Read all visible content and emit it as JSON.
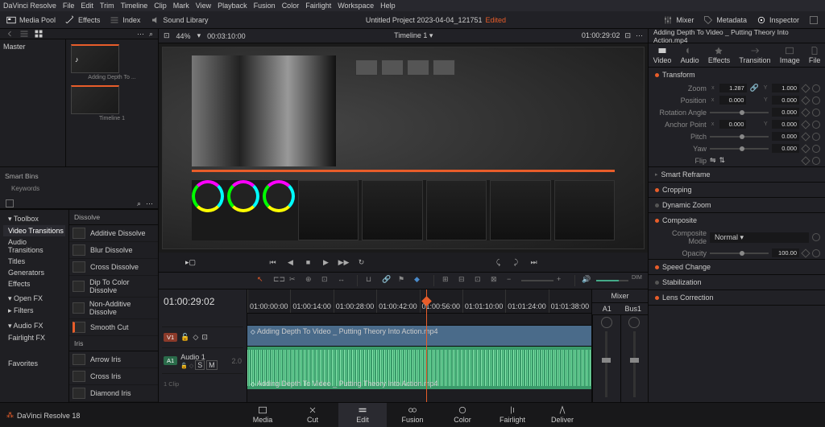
{
  "menubar": [
    "DaVinci Resolve",
    "File",
    "Edit",
    "Trim",
    "Timeline",
    "Clip",
    "Mark",
    "View",
    "Playback",
    "Fusion",
    "Color",
    "Fairlight",
    "Workspace",
    "Help"
  ],
  "topbar": {
    "left": [
      {
        "icon": "media-pool",
        "label": "Media Pool",
        "active": true
      },
      {
        "icon": "effects",
        "label": "Effects",
        "active": true
      },
      {
        "icon": "index",
        "label": "Index"
      },
      {
        "icon": "sound",
        "label": "Sound Library"
      }
    ],
    "title": "Untitled Project 2023-04-04_121751",
    "edited": "Edited",
    "right": [
      {
        "icon": "mixer",
        "label": "Mixer"
      },
      {
        "icon": "metadata",
        "label": "Metadata"
      },
      {
        "icon": "inspector",
        "label": "Inspector",
        "active": true
      }
    ]
  },
  "viewer": {
    "zoom": "44%",
    "left_tc": "00:03:10:00",
    "timeline_name": "Timeline 1",
    "right_tc": "01:00:29:02"
  },
  "mediapool": {
    "master": "Master",
    "thumbs": [
      {
        "label": "Adding Depth To ..."
      },
      {
        "label": "Timeline 1"
      }
    ],
    "smart_bins_hdr": "Smart Bins",
    "smart_bins": [
      "Keywords"
    ]
  },
  "toolbox": {
    "header": "Toolbox",
    "tree": [
      "Video Transitions",
      "Audio Transitions",
      "Titles",
      "Generators",
      "Effects"
    ],
    "openfx": "Open FX",
    "filters": "Filters",
    "audiofx": "Audio FX",
    "fairlight": "Fairlight FX",
    "favorites": "Favorites",
    "dissolve_hdr": "Dissolve",
    "dissolves": [
      "Additive Dissolve",
      "Blur Dissolve",
      "Cross Dissolve",
      "Dip To Color Dissolve",
      "Non-Additive Dissolve",
      "Smooth Cut"
    ],
    "iris_hdr": "Iris",
    "iris": [
      "Arrow Iris",
      "Cross Iris",
      "Diamond Iris"
    ]
  },
  "inspector": {
    "clip": "Adding Depth To Video _ Putting Theory Into Action.mp4",
    "tabs": [
      "Video",
      "Audio",
      "Effects",
      "Transition",
      "Image",
      "File"
    ],
    "transform": {
      "header": "Transform",
      "zoom": "Zoom",
      "zoom_x": "1.287",
      "zoom_y": "1.000",
      "position": "Position",
      "pos_x": "0.000",
      "pos_y": "0.000",
      "rotation": "Rotation Angle",
      "rotation_v": "0.000",
      "anchor": "Anchor Point",
      "anchor_x": "0.000",
      "anchor_y": "0.000",
      "pitch": "Pitch",
      "pitch_v": "0.000",
      "yaw": "Yaw",
      "yaw_v": "0.000",
      "flip": "Flip"
    },
    "sections": [
      "Smart Reframe",
      "Cropping",
      "Dynamic Zoom",
      "Composite",
      "Speed Change",
      "Stabilization",
      "Lens Correction"
    ],
    "composite_mode_label": "Composite Mode",
    "composite_mode": "Normal",
    "opacity_label": "Opacity",
    "opacity": "100.00"
  },
  "timeline": {
    "tc": "01:00:29:02",
    "ruler": [
      "01:00:00:00",
      "01:00:14:00",
      "01:00:28:00",
      "01:00:42:00",
      "01:00:56:00",
      "01:01:10:00",
      "01:01:24:00",
      "01:01:38:00"
    ],
    "v1": "V1",
    "a1": "A1",
    "a1_label": "Audio 1",
    "a1_ch": "2.0",
    "clip_count": "1 Clip",
    "video_clip": "Adding Depth To Video _ Putting Theory Into Action.mp4",
    "audio_clip": "Adding Depth To Video _ Putting Theory Into Action.mp4"
  },
  "mixer": {
    "header": "Mixer",
    "a1": "A1",
    "bus": "Bus1"
  },
  "pages": [
    "Media",
    "Cut",
    "Edit",
    "Fusion",
    "Color",
    "Fairlight",
    "Deliver"
  ],
  "active_page": "Edit",
  "app_badge": "DaVinci Resolve 18"
}
